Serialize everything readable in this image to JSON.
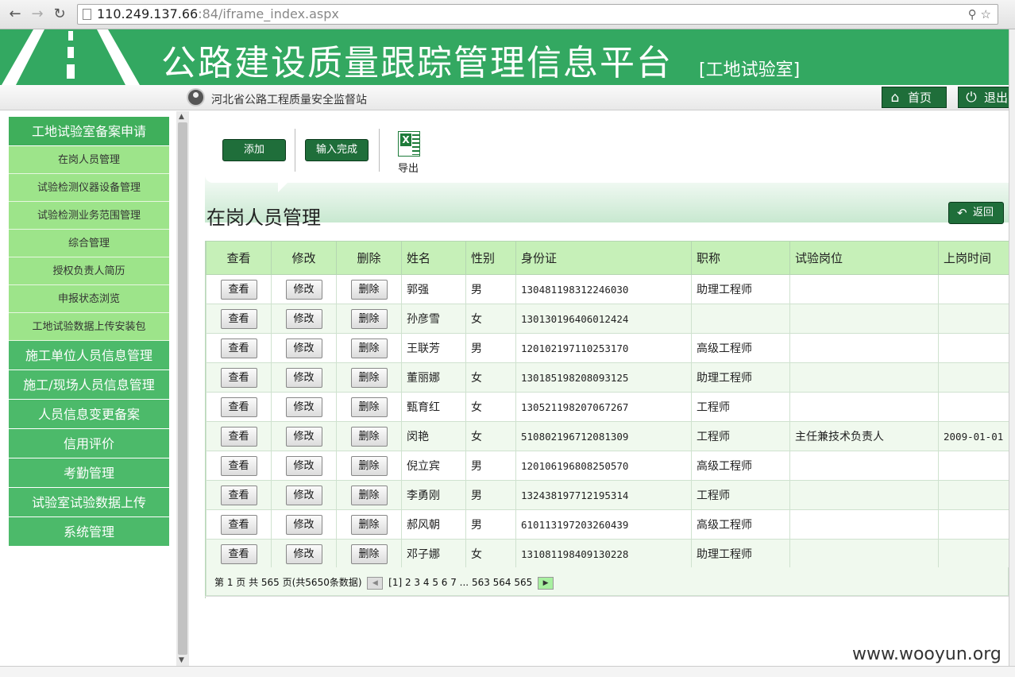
{
  "browser": {
    "url_host": "110.249.137.66",
    "url_port": ":84",
    "url_path": "/iframe_index.aspx"
  },
  "banner": {
    "title": "公路建设质量跟踪管理信息平台",
    "subtitle": "[工地试验室]"
  },
  "header": {
    "org_name": "河北省公路工程质量安全监督站",
    "home_label": "首页",
    "logout_label": "退出"
  },
  "sidebar": {
    "items": [
      {
        "label": "工地试验室备案申请",
        "type": "head"
      },
      {
        "label": "在岗人员管理",
        "type": "sub"
      },
      {
        "label": "试验检测仪器设备管理",
        "type": "sub"
      },
      {
        "label": "试验检测业务范围管理",
        "type": "sub"
      },
      {
        "label": "综合管理",
        "type": "sub"
      },
      {
        "label": "授权负责人简历",
        "type": "sub"
      },
      {
        "label": "申报状态浏览",
        "type": "sub"
      },
      {
        "label": "工地试验数据上传安装包",
        "type": "sub"
      },
      {
        "label": "施工单位人员信息管理",
        "type": "head"
      },
      {
        "label": "施工/现场人员信息管理",
        "type": "head"
      },
      {
        "label": "人员信息变更备案",
        "type": "head"
      },
      {
        "label": "信用评价",
        "type": "head"
      },
      {
        "label": "考勤管理",
        "type": "head"
      },
      {
        "label": "试验室试验数据上传",
        "type": "head"
      },
      {
        "label": "系统管理",
        "type": "head"
      }
    ]
  },
  "toolbar": {
    "add_label": "添加",
    "done_label": "输入完成",
    "excel_glyph": "X",
    "export_label": "导出"
  },
  "page": {
    "title": "在岗人员管理",
    "back_label": "返回"
  },
  "table": {
    "headers": [
      "查看",
      "修改",
      "删除",
      "姓名",
      "性别",
      "身份证",
      "职称",
      "试验岗位",
      "上岗时间"
    ],
    "view_label": "查看",
    "edit_label": "修改",
    "delete_label": "删除",
    "rows": [
      {
        "name": "郭强",
        "gender": "男",
        "id": "130481198312246030",
        "title": "助理工程师",
        "post": "",
        "start": ""
      },
      {
        "name": "孙彦雪",
        "gender": "女",
        "id": "130130196406012424",
        "title": "",
        "post": "",
        "start": ""
      },
      {
        "name": "王联芳",
        "gender": "男",
        "id": "120102197110253170",
        "title": "高级工程师",
        "post": "",
        "start": ""
      },
      {
        "name": "董丽娜",
        "gender": "女",
        "id": "130185198208093125",
        "title": "助理工程师",
        "post": "",
        "start": ""
      },
      {
        "name": "甄育红",
        "gender": "女",
        "id": "130521198207067267",
        "title": "工程师",
        "post": "",
        "start": ""
      },
      {
        "name": "闵艳",
        "gender": "女",
        "id": "510802196712081309",
        "title": "工程师",
        "post": "主任兼技术负责人",
        "start": "2009-01-01"
      },
      {
        "name": "倪立宾",
        "gender": "男",
        "id": "120106196808250570",
        "title": "高级工程师",
        "post": "",
        "start": ""
      },
      {
        "name": "李勇刚",
        "gender": "男",
        "id": "132438197712195314",
        "title": "工程师",
        "post": "",
        "start": ""
      },
      {
        "name": "郝风朝",
        "gender": "男",
        "id": "610113197203260439",
        "title": "高级工程师",
        "post": "",
        "start": ""
      },
      {
        "name": "邓子娜",
        "gender": "女",
        "id": "131081198409130228",
        "title": "助理工程师",
        "post": "",
        "start": ""
      }
    ]
  },
  "pager": {
    "summary": "第 1 页 共 565 页(共5650条数据)",
    "pages": "[1] 2 3 4 5 6 7 ... 563 564 565"
  },
  "watermark": "www.wooyun.org",
  "colors": {
    "banner": "#33a861",
    "sidebar_head": "#4cba6a",
    "sidebar_sub": "#9de48a",
    "button": "#1f6e3a",
    "table_header": "#c6f0b8"
  }
}
